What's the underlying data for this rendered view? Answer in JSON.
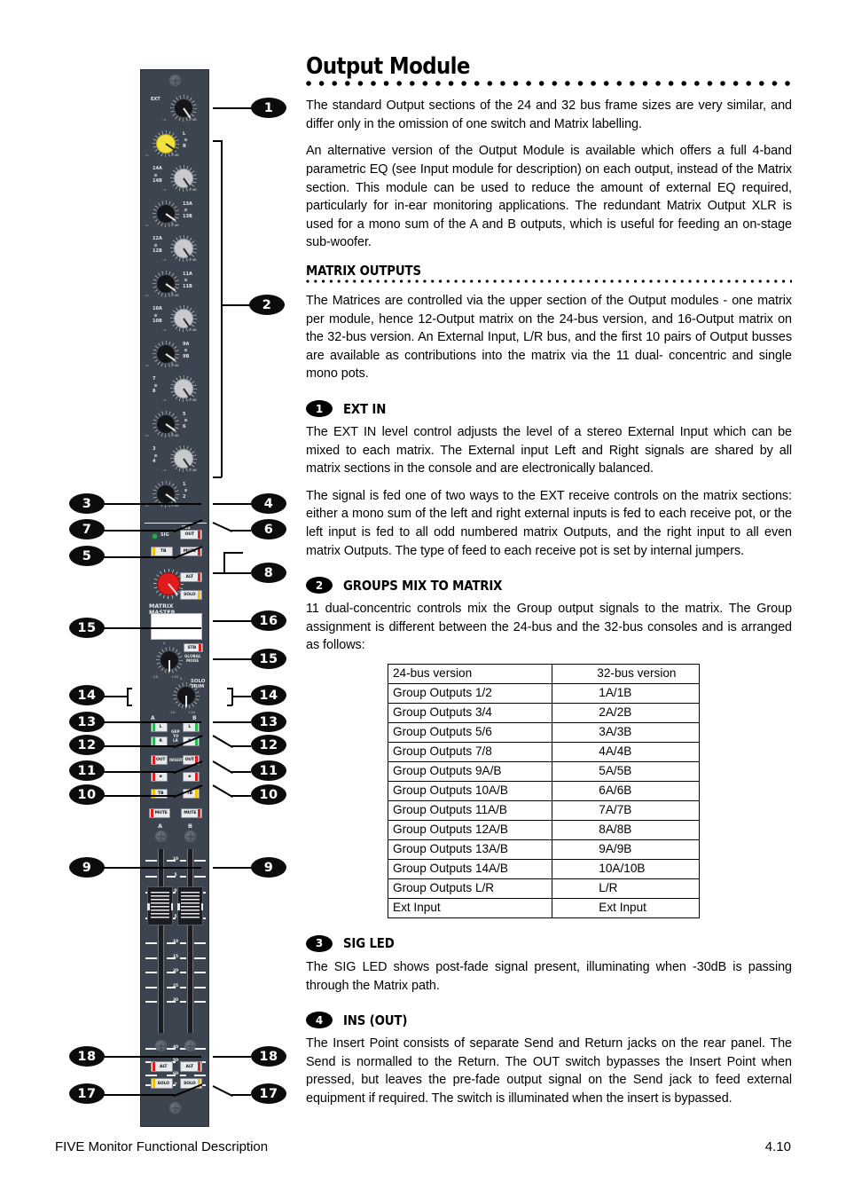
{
  "page": {
    "title": "Output Module",
    "footer_left": "FIVE Monitor Functional Description",
    "footer_right": "4.10"
  },
  "intro": {
    "p1": "The standard Output sections of the 24 and 32 bus frame sizes are very similar, and differ only in the omission of one switch and Matrix labelling.",
    "p2": "An alternative version of the Output Module is available which offers a full 4-band parametric EQ (see Input module for description) on each output, instead of the Matrix section. This module can be used to reduce the amount of external EQ required, particularly for in-ear monitoring applications.  The redundant Matrix Output XLR is used for a mono sum of the A and B outputs, which is useful for feeding an on-stage sub-woofer."
  },
  "matrix_outputs": {
    "heading": "MATRIX OUTPUTS",
    "p1": "The Matrices are controlled via the upper section of the Output modules  -  one matrix per module, hence 12-Output matrix on the 24-bus version, and 16-Output matrix on the 32-bus version. An External Input, L/R bus, and the first 10 pairs of Output busses are available as contributions into the matrix via the 11 dual- concentric and single mono pots."
  },
  "ext_in": {
    "num": "1",
    "heading": "EXT IN",
    "p1": "The EXT IN level control adjusts the level of a stereo External Input which can be mixed to each matrix. The External input Left and Right signals are shared by all matrix sections in the console and are electronically balanced.",
    "p2": "The signal is fed one of two ways to the EXT receive controls on the matrix sections: either a mono sum of the left and right external inputs is fed to each receive pot, or the left input is fed to all odd numbered matrix Outputs, and the right input to all even matrix Outputs. The type of feed to each receive pot is set by internal jumpers."
  },
  "groups_mix": {
    "num": "2",
    "heading": "GROUPS MIX TO MATRIX",
    "p1": "11 dual-concentric controls mix the Group output signals to the matrix. The Group assignment is different between the 24-bus and the 32-bus consoles and is arranged as follows:",
    "table": {
      "headers": [
        "24-bus version",
        "32-bus version"
      ],
      "rows": [
        [
          "Group Outputs 1/2",
          "1A/1B"
        ],
        [
          "Group Outputs 3/4",
          "2A/2B"
        ],
        [
          "Group Outputs 5/6",
          "3A/3B"
        ],
        [
          "Group Outputs 7/8",
          "4A/4B"
        ],
        [
          "Group Outputs 9A/B",
          "5A/5B"
        ],
        [
          "Group Outputs 10A/B",
          "6A/6B"
        ],
        [
          "Group Outputs 11A/B",
          "7A/7B"
        ],
        [
          "Group Outputs 12A/B",
          "8A/8B"
        ],
        [
          "Group Outputs 13A/B",
          "9A/9B"
        ],
        [
          "Group Outputs 14A/B",
          "10A/10B"
        ],
        [
          "Group Outputs L/R",
          "L/R"
        ],
        [
          "Ext Input",
          "Ext Input"
        ]
      ]
    }
  },
  "sig_led": {
    "num": "3",
    "heading": "SIG LED",
    "p1": "The SIG LED shows post-fade signal present, illuminating when -30dB is passing through the Matrix path."
  },
  "ins_out": {
    "num": "4",
    "heading": "INS (OUT)",
    "p1": "The Insert Point consists of separate Send and Return jacks on the rear panel.  The Send is normalled to the Return. The OUT switch bypasses the Insert Point when pressed, but leaves the pre-fade output signal on the Send jack to feed external equipment if required.  The switch is illuminated when the insert is bypassed."
  },
  "console": {
    "ext_label": "EXT",
    "db_label": "0 dB",
    "minus_inf": "-∞",
    "pot_labels": [
      {
        "id": "ext",
        "name": "EXT"
      },
      {
        "id": "lr",
        "top": "L",
        "bottom": "R"
      },
      {
        "id": "14",
        "top": "14A",
        "bottom": "14B"
      },
      {
        "id": "13",
        "top": "13A",
        "bottom": "13B"
      },
      {
        "id": "12",
        "top": "12A",
        "bottom": "12B"
      },
      {
        "id": "11",
        "top": "11A",
        "bottom": "11B"
      },
      {
        "id": "10",
        "top": "10A",
        "bottom": "10B"
      },
      {
        "id": "9",
        "top": "9A",
        "bottom": "9B"
      },
      {
        "id": "78",
        "top": "7",
        "bottom": "8"
      },
      {
        "id": "56",
        "top": "5",
        "bottom": "6"
      },
      {
        "id": "34",
        "top": "3",
        "bottom": "4"
      },
      {
        "id": "12b",
        "top": "1",
        "bottom": "2"
      }
    ],
    "ins_label": "INS",
    "sig_label": "SIG",
    "out_label": "OUT",
    "mute_label": "MUTE",
    "tb_label": "TB",
    "alt_label": "ALT",
    "solo_label": "SOLO",
    "matrix_master": "MATRIX\nMASTER",
    "matrix_master_l1": "MATRIX",
    "matrix_master_l2": "MASTER",
    "stb_label": "STB",
    "global_mode_l1": "GLOBAL",
    "global_mode_l2": "MODE",
    "solo_trim_l1": "SOLO",
    "solo_trim_l2": "TRIM",
    "zero": "0",
    "minus10": "-10",
    "plus10": "+10",
    "bus_a": "A",
    "bus_b": "B",
    "l_label": "L",
    "r_label": "R",
    "grp_to_lr_l1": "GRP",
    "grp_to_lr_l2": "TO",
    "grp_to_lr_l3": "LR",
    "insert_label": "INSERT",
    "phase_label": "ø",
    "fader_ticks": [
      "10",
      "5",
      "0",
      "5",
      "10",
      "15",
      "20",
      "25",
      "30",
      "40",
      "50",
      "60",
      "∞"
    ]
  },
  "callouts": [
    {
      "n": "1"
    },
    {
      "n": "2"
    },
    {
      "n": "3"
    },
    {
      "n": "4"
    },
    {
      "n": "5"
    },
    {
      "n": "6"
    },
    {
      "n": "7"
    },
    {
      "n": "8"
    },
    {
      "n": "9"
    },
    {
      "n": "10"
    },
    {
      "n": "11"
    },
    {
      "n": "12"
    },
    {
      "n": "13"
    },
    {
      "n": "14"
    },
    {
      "n": "15"
    },
    {
      "n": "16"
    },
    {
      "n": "17"
    },
    {
      "n": "18"
    }
  ]
}
